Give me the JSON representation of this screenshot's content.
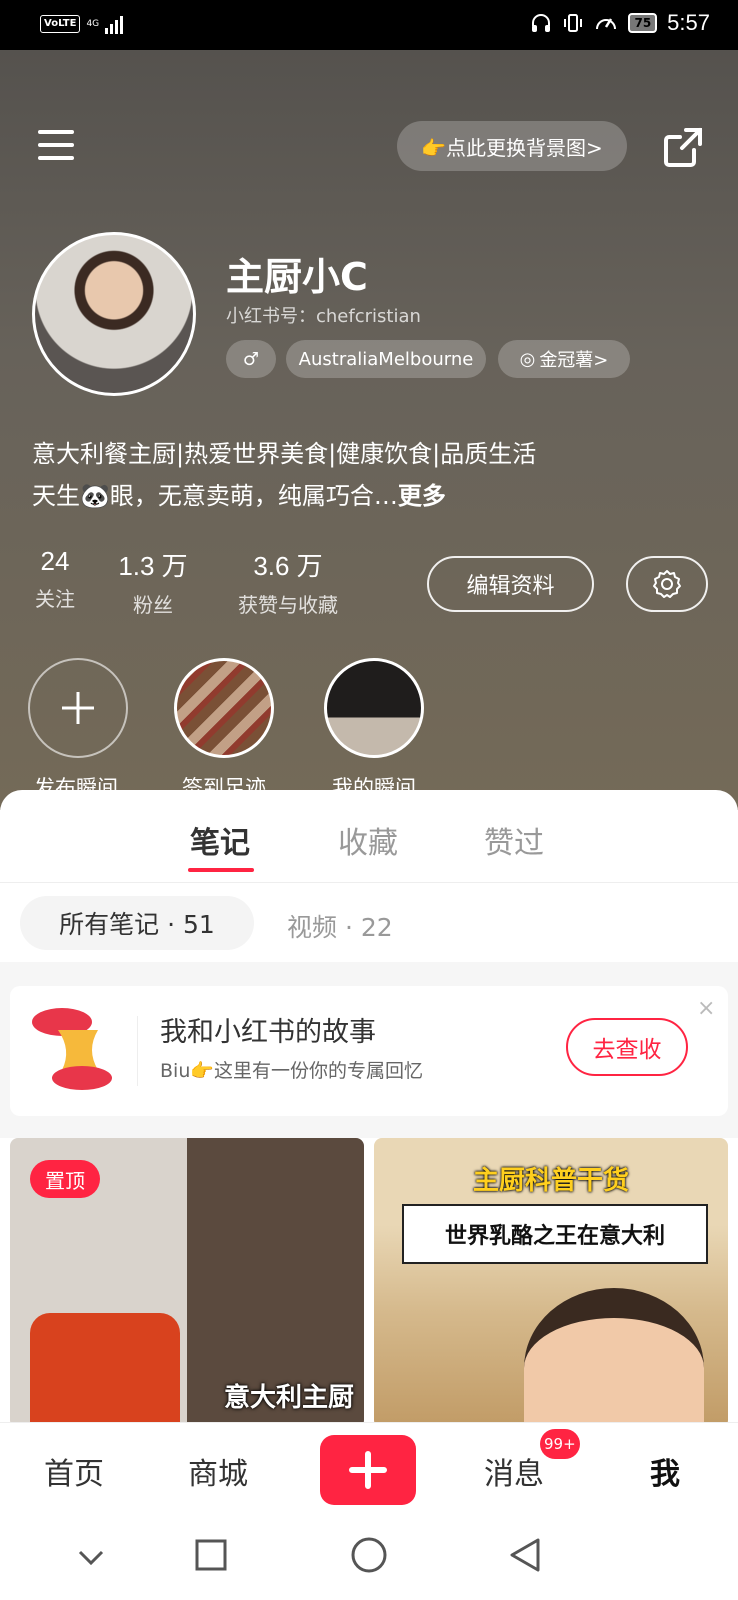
{
  "status_bar": {
    "volte": "VoLTE",
    "network": "4G",
    "battery": "75",
    "time": "5:57"
  },
  "header": {
    "change_bg_label": "👉点此更换背景图>",
    "user_name": "主厨小C",
    "user_id": "小红书号：chefcristian",
    "tags": [
      "♂",
      "AustraliaMelbourne",
      "金冠薯>"
    ],
    "bio_line1": "意大利餐主厨|热爱世界美食|健康饮食|品质生活",
    "bio_line2": "天生🐼眼，无意卖萌，纯属巧合…",
    "bio_more": "更多",
    "stats": [
      {
        "num": "24",
        "label": "关注"
      },
      {
        "num": "1.3 万",
        "label": "粉丝"
      },
      {
        "num": "3.6 万",
        "label": "获赞与收藏"
      }
    ],
    "edit_profile_label": "编辑资料",
    "moments": [
      {
        "label": "发布瞬间"
      },
      {
        "label": "签到足迹"
      },
      {
        "label": "我的瞬间"
      }
    ]
  },
  "tabs": [
    {
      "label": "笔记"
    },
    {
      "label": "收藏"
    },
    {
      "label": "赞过"
    }
  ],
  "filters": {
    "all_notes": "所有笔记 · 51",
    "videos": "视频 · 22"
  },
  "story": {
    "title": "我和小红书的故事",
    "subtitle": "Biu👉这里有一份你的专属回忆",
    "button": "去查收",
    "close": "×"
  },
  "notes": [
    {
      "badge": "置顶",
      "caption": "意大利主厨"
    },
    {
      "title": "主厨科普干货",
      "banner": "世界乳酪之王在意大利"
    }
  ],
  "bottom_nav": {
    "items": [
      "首页",
      "商城",
      "消息",
      "我"
    ],
    "message_badge": "99+"
  },
  "colors": {
    "accent": "#ff2442",
    "header_bg": "#67625a"
  }
}
